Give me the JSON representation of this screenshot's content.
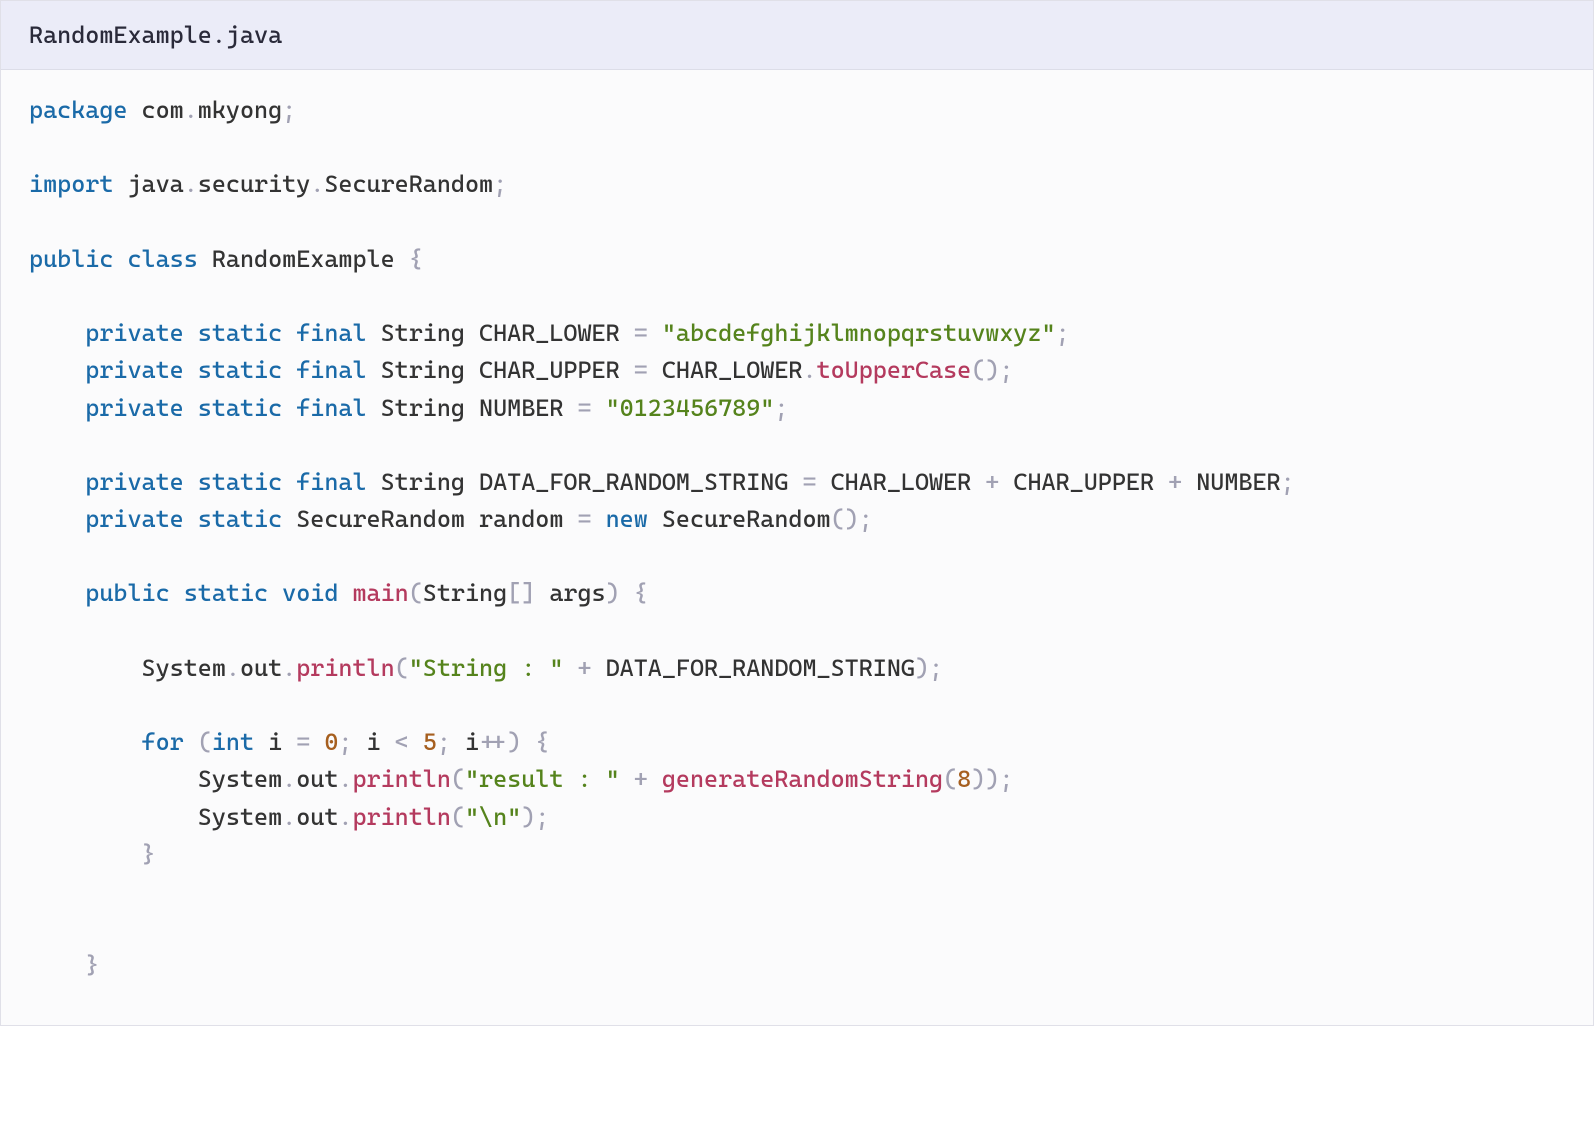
{
  "header": {
    "filename": "RandomExample.java"
  },
  "code": {
    "package_kw": "package",
    "package_name": "com",
    "package_name2": "mkyong",
    "import_kw": "import",
    "import_p1": "java",
    "import_p2": "security",
    "import_p3": "SecureRandom",
    "public_kw": "public",
    "class_kw": "class",
    "class_name": "RandomExample",
    "private_kw": "private",
    "static_kw": "static",
    "final_kw": "final",
    "void_kw": "void",
    "new_kw": "new",
    "for_kw": "for",
    "int_kw": "int",
    "string_type": "String",
    "securerandom_type": "SecureRandom",
    "char_lower": "CHAR_LOWER",
    "char_upper": "CHAR_UPPER",
    "number_const": "NUMBER",
    "data_for_random": "DATA_FOR_RANDOM_STRING",
    "random_var": "random",
    "str_alpha": "\"abcdefghijklmnopqrstuvwxyz\"",
    "str_digits": "\"0123456789\"",
    "str_prefix1": "\"String : \"",
    "str_prefix2": "\"result : \"",
    "str_newline": "\"\\n\"",
    "to_upper": "toUpperCase",
    "main_fn": "main",
    "args": "args",
    "system": "System",
    "out": "out",
    "println": "println",
    "gen_fn": "generateRandomString",
    "i_var": "i",
    "zero": "0",
    "five": "5",
    "eight": "8",
    "dot": ".",
    "semi": ";",
    "comma": ",",
    "eq": "=",
    "lt": "<",
    "plus": "+",
    "plusplus": "++",
    "lparen": "(",
    "rparen": ")",
    "lbrace": "{",
    "rbrace": "}",
    "lbrack": "[]"
  }
}
